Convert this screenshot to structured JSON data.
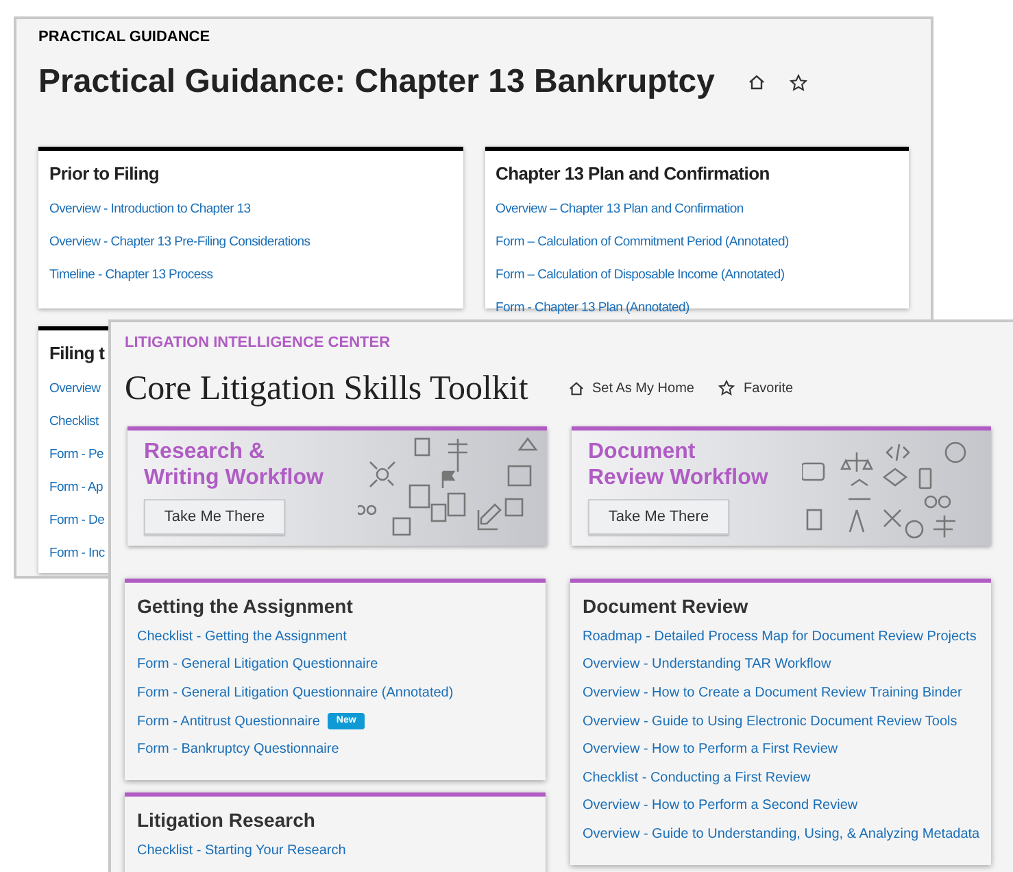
{
  "back_window": {
    "section_label": "PRACTICAL GUIDANCE",
    "title": "Practical Guidance: Chapter 13 Bankruptcy",
    "cards": [
      {
        "title": "Prior to Filing",
        "links": [
          {
            "text": "Overview - Introduction to Chapter 13"
          },
          {
            "text": "Overview - Chapter 13 Pre-Filing Considerations"
          },
          {
            "text": "Timeline - Chapter 13 Process"
          }
        ]
      },
      {
        "title": "Chapter 13 Plan and Confirmation",
        "links": [
          {
            "text": "Overview – Chapter 13 Plan and Confirmation"
          },
          {
            "text": "Form – Calculation of Commitment Period (Annotated)"
          },
          {
            "text": "Form – Calculation of Disposable Income (Annotated)"
          },
          {
            "text": "Form - Chapter 13 Plan (Annotated)"
          }
        ]
      },
      {
        "title": "Filing t",
        "links": [
          {
            "text": "Overview"
          },
          {
            "text": "Checklist"
          },
          {
            "text": "Form - Pe"
          },
          {
            "text": "Form - Ap"
          },
          {
            "text": "Form - De"
          },
          {
            "text": "Form - Inc"
          }
        ]
      }
    ]
  },
  "front_window": {
    "section_label": "LITIGATION INTELLIGENCE CENTER",
    "title": "Core Litigation Skills Toolkit",
    "actions": [
      {
        "kind": "home",
        "label": "Set As My Home"
      },
      {
        "kind": "favorite",
        "label": "Favorite"
      }
    ],
    "banners": [
      {
        "title": "Research & Writing Workflow",
        "button": "Take Me There"
      },
      {
        "title": "Document Review Workflow",
        "button": "Take Me There"
      }
    ],
    "columns": [
      [
        {
          "title": "Getting the Assignment",
          "links": [
            {
              "text": "Checklist - Getting the Assignment"
            },
            {
              "text": "Form - General Litigation Questionnaire"
            },
            {
              "text": "Form - General Litigation Questionnaire (Annotated)"
            },
            {
              "text": "Form - Antitrust Questionnaire",
              "badge": "New"
            },
            {
              "text": "Form - Bankruptcy Questionnaire"
            }
          ]
        },
        {
          "title": "Litigation Research",
          "links": [
            {
              "text": "Checklist - Starting Your Research"
            }
          ]
        }
      ],
      [
        {
          "title": "Document Review",
          "links": [
            {
              "text": "Roadmap - Detailed Process Map for Document Review Projects"
            },
            {
              "text": "Overview - Understanding TAR Workflow"
            },
            {
              "text": "Overview - How to Create a Document Review Training Binder"
            },
            {
              "text": "Overview - Guide to Using Electronic Document Review Tools"
            },
            {
              "text": "Overview - How to Perform a First Review"
            },
            {
              "text": "Checklist - Conducting a First Review"
            },
            {
              "text": "Overview - How to Perform a Second Review"
            },
            {
              "text": "Overview - Guide to Understanding, Using, & Analyzing Metadata"
            }
          ]
        }
      ]
    ]
  }
}
